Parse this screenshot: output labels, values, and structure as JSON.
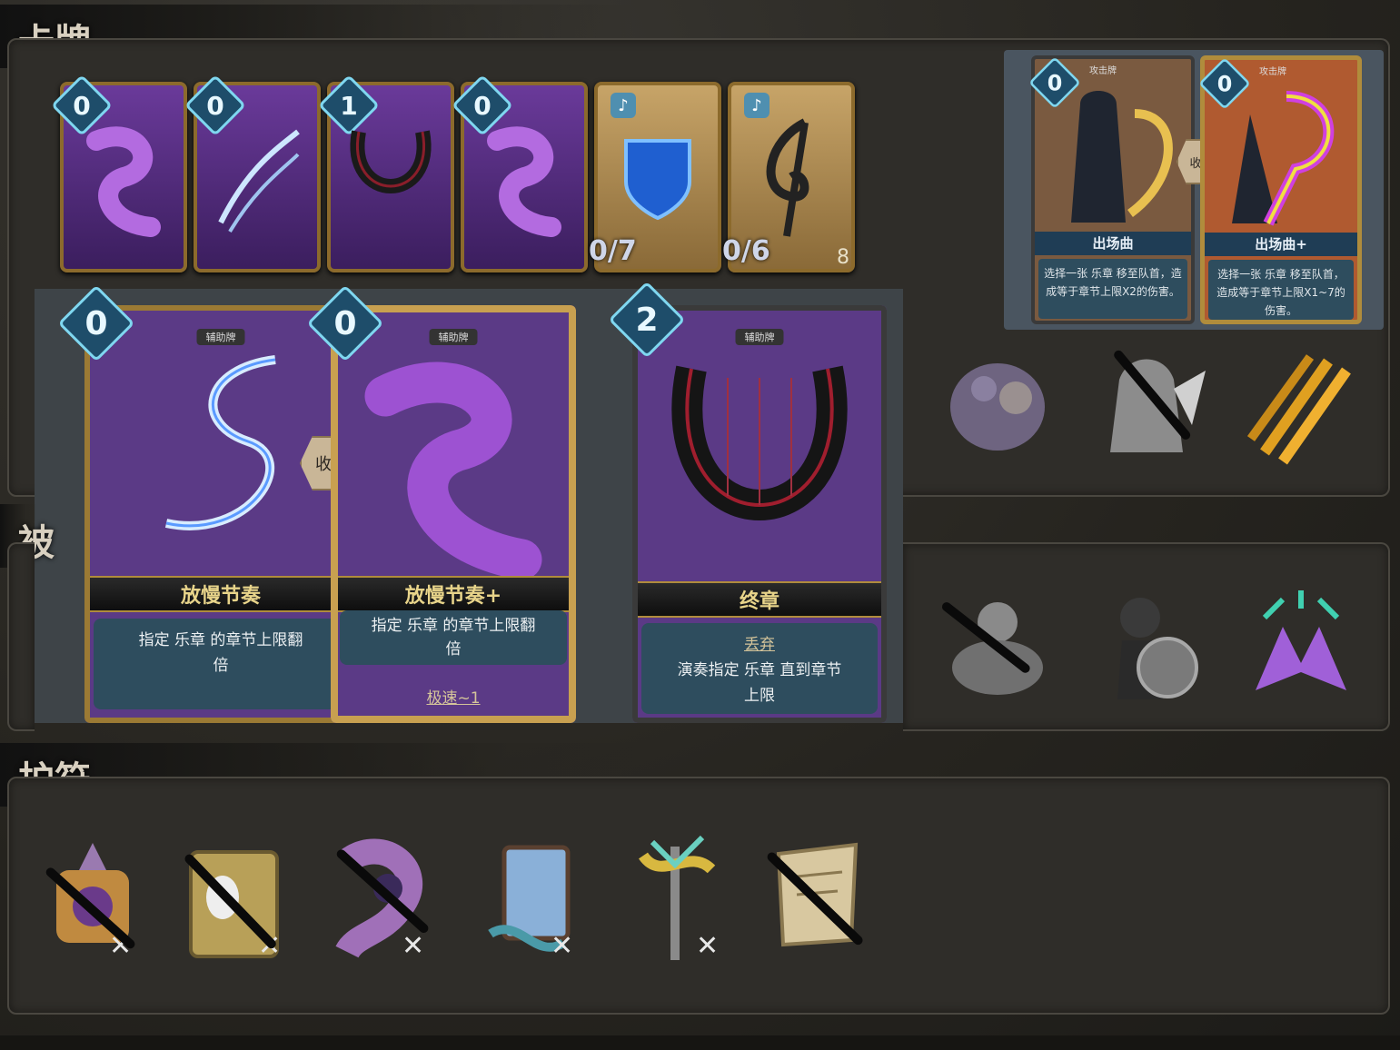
{
  "sections": {
    "cards_title": "卡牌",
    "amulets_title": "护符",
    "blessing_title_partial": "被"
  },
  "mini_cards": [
    {
      "cost": "0",
      "style": "purple"
    },
    {
      "cost": "0",
      "style": "purple"
    },
    {
      "cost": "1",
      "style": "purple"
    },
    {
      "cost": "0",
      "style": "purple"
    },
    {
      "cost": "",
      "style": "gold",
      "counter": "0/7"
    },
    {
      "cost": "",
      "style": "gold",
      "counter": "0/6",
      "extra": "8"
    }
  ],
  "tooltip_cards": [
    {
      "cost": "0",
      "type": "攻击牌",
      "name": "出场曲",
      "desc": "选择一张 乐章 移至队首，造成等于章节上限X2的伤害。"
    },
    {
      "cost": "0",
      "type": "攻击牌",
      "name": "出场曲+",
      "desc": "选择一张 乐章 移至队首，造成等于章节上限X1~7的伤害。"
    }
  ],
  "tooltip_collapse": "收起",
  "big_cards": [
    {
      "cost": "0",
      "type": "辅助牌",
      "name": "放慢节奏",
      "desc_line1": "指定 乐章 的章节上限翻",
      "desc_line2": "倍"
    },
    {
      "cost": "0",
      "type": "辅助牌",
      "name": "放慢节奏+",
      "desc_line1": "指定 乐章 的章节上限翻",
      "desc_line2": "倍",
      "keyword": "极速~1"
    },
    {
      "cost": "2",
      "type": "辅助牌",
      "name": "终章",
      "keyword": "丢弃",
      "desc_line1": "演奏指定 乐章 直到章节",
      "desc_line2": "上限"
    }
  ],
  "big_collapse": "收起",
  "colors": {
    "accent_gold": "#b08c3c",
    "card_purple": "#5b3a86",
    "cost_cyan": "#7fd7f0",
    "desc_blue": "#2e4d5e"
  },
  "enemies_row1": [
    {
      "icon": "mutant-brute-icon",
      "crossed": false
    },
    {
      "icon": "winged-statue-icon",
      "crossed": true
    },
    {
      "icon": "claw-slash-icon",
      "crossed": false
    }
  ],
  "enemies_row2": [
    {
      "icon": "stone-golem-icon",
      "crossed": true
    },
    {
      "icon": "shield-warrior-icon",
      "crossed": false
    },
    {
      "icon": "purple-crown-burst-icon",
      "crossed": false
    }
  ],
  "amulets": [
    {
      "icon": "music-box-amulet-icon",
      "crossed": true,
      "compressed": true
    },
    {
      "icon": "mask-book-amulet-icon",
      "crossed": true,
      "compressed": true
    },
    {
      "icon": "purple-scroll-amulet-icon",
      "crossed": true,
      "compressed": true
    },
    {
      "icon": "blue-tome-amulet-icon",
      "crossed": false,
      "compressed": true
    },
    {
      "icon": "golden-staff-amulet-icon",
      "crossed": false,
      "compressed": true
    },
    {
      "icon": "parchment-amulet-icon",
      "crossed": true,
      "compressed": false
    }
  ]
}
